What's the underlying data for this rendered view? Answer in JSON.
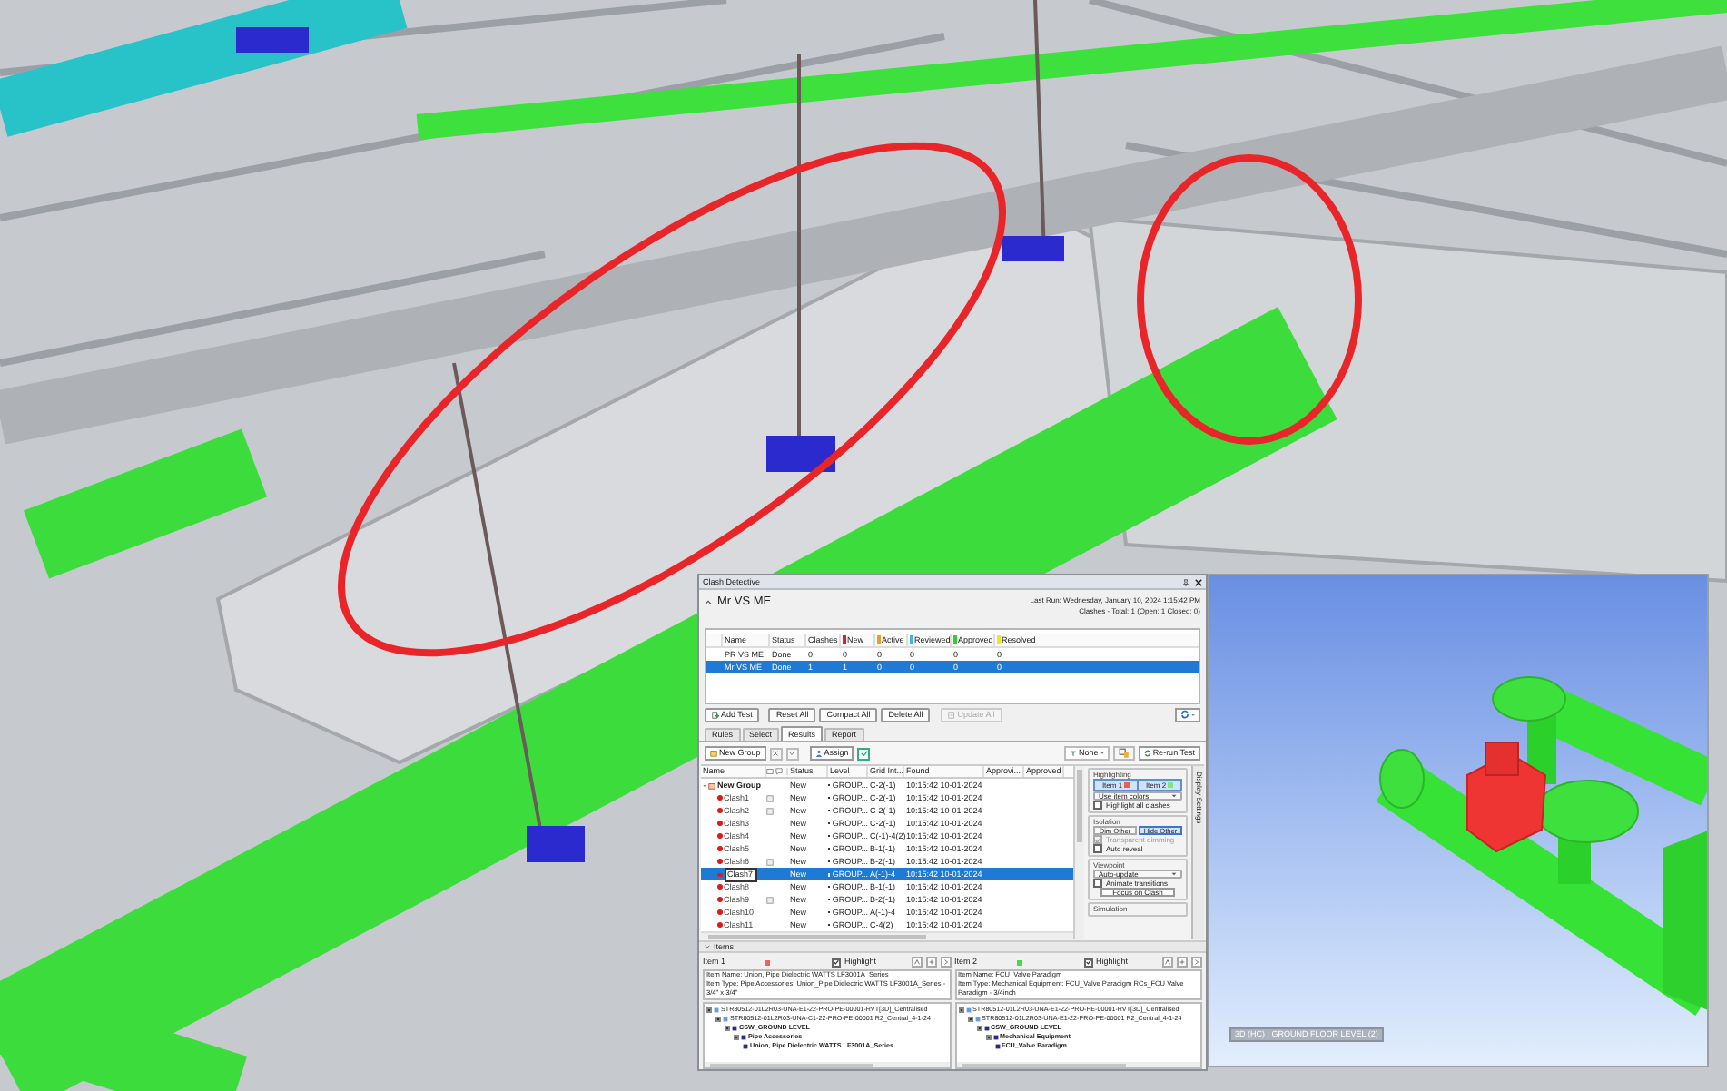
{
  "panel": {
    "title": "Clash Detective",
    "test_name": "Mr VS ME",
    "expanded": true,
    "last_run": "Last Run: Wednesday, January 10, 2024 1:15:42 PM",
    "summary": "Clashes - Total: 1  (Open: 1  Closed: 0)",
    "tests": {
      "columns": [
        {
          "label": "Name"
        },
        {
          "label": "Status"
        },
        {
          "label": "Clashes"
        },
        {
          "label": "New",
          "color": "#e02020"
        },
        {
          "label": "Active",
          "color": "#f39a1f"
        },
        {
          "label": "Reviewed",
          "color": "#3ab8e8"
        },
        {
          "label": "Approved",
          "color": "#2ed12e"
        },
        {
          "label": "Resolved",
          "color": "#f2e22a"
        }
      ],
      "rows": [
        {
          "cells": [
            "PR VS ME",
            "Done",
            "0",
            "0",
            "0",
            "0",
            "0",
            "0"
          ],
          "selected": false
        },
        {
          "cells": [
            "Mr VS ME",
            "Done",
            "1",
            "1",
            "0",
            "0",
            "0",
            "0"
          ],
          "selected": true
        }
      ]
    },
    "test_buttons": [
      {
        "label": "Add Test",
        "kind": "add",
        "disabled": false
      },
      {
        "label": "Reset All",
        "kind": "plain",
        "disabled": false
      },
      {
        "label": "Compact All",
        "kind": "plain",
        "disabled": false
      },
      {
        "label": "Delete All",
        "kind": "plain",
        "disabled": false
      },
      {
        "label": "Update All",
        "kind": "update",
        "disabled": true
      }
    ],
    "tabs": [
      {
        "label": "Rules",
        "selected": false
      },
      {
        "label": "Select",
        "selected": false
      },
      {
        "label": "Results",
        "selected": true
      },
      {
        "label": "Report",
        "selected": false
      }
    ],
    "toolbar": {
      "new_group": "New Group",
      "assign": "Assign",
      "filter": "None",
      "rerun": "Re-run Test"
    },
    "results": {
      "columns": [
        "Name",
        "Status",
        "Level",
        "Grid Int...",
        "Found",
        "Approvi...",
        "Approved"
      ],
      "rows": [
        {
          "name": "New Group",
          "expanded": true,
          "selected": false,
          "status": "New",
          "level": "GROUP...",
          "grid": "C-2(-1)",
          "found": "10:15:42 10-01-2024",
          "children": [
            {
              "name": "Clash1",
              "selected": false,
              "comment": true,
              "status": "New",
              "level": "GROUP...",
              "grid": "C-2(-1)",
              "found": "10:15:42 10-01-2024"
            },
            {
              "name": "Clash2",
              "selected": false,
              "comment": true,
              "status": "New",
              "level": "GROUP...",
              "grid": "C-2(-1)",
              "found": "10:15:42 10-01-2024"
            },
            {
              "name": "Clash3",
              "selected": false,
              "comment": false,
              "status": "New",
              "level": "GROUP...",
              "grid": "C-2(-1)",
              "found": "10:15:42 10-01-2024"
            },
            {
              "name": "Clash4",
              "selected": false,
              "comment": false,
              "status": "New",
              "level": "GROUP...",
              "grid": "C(-1)-4(2)",
              "found": "10:15:42 10-01-2024"
            },
            {
              "name": "Clash5",
              "selected": false,
              "comment": false,
              "status": "New",
              "level": "GROUP...",
              "grid": "B-1(-1)",
              "found": "10:15:42 10-01-2024"
            },
            {
              "name": "Clash6",
              "selected": false,
              "comment": true,
              "status": "New",
              "level": "GROUP...",
              "grid": "B-2(-1)",
              "found": "10:15:42 10-01-2024"
            },
            {
              "name": "Clash7",
              "selected": true,
              "comment": false,
              "status": "New",
              "level": "GROUP...",
              "grid": "A(-1)-4",
              "found": "10:15:42 10-01-2024"
            },
            {
              "name": "Clash8",
              "selected": false,
              "comment": false,
              "status": "New",
              "level": "GROUP...",
              "grid": "B-1(-1)",
              "found": "10:15:42 10-01-2024"
            },
            {
              "name": "Clash9",
              "selected": false,
              "comment": true,
              "status": "New",
              "level": "GROUP...",
              "grid": "B-2(-1)",
              "found": "10:15:42 10-01-2024"
            },
            {
              "name": "Clash10",
              "selected": false,
              "comment": false,
              "status": "New",
              "level": "GROUP...",
              "grid": "A(-1)-4",
              "found": "10:15:42 10-01-2024"
            },
            {
              "name": "Clash11",
              "selected": false,
              "comment": false,
              "status": "New",
              "level": "GROUP...",
              "grid": "C-4(2)",
              "found": "10:15:42 10-01-2024"
            }
          ]
        }
      ]
    },
    "settings": {
      "title": "Display Settings",
      "highlighting": {
        "title": "Highlighting",
        "items": [
          {
            "label": "Item 1",
            "color": "#ef5b5b"
          },
          {
            "label": "Item 2",
            "color": "#7ee87e"
          }
        ],
        "mode": "Use item colors",
        "highlight_all": {
          "label": "Highlight all clashes",
          "checked": false
        }
      },
      "isolation": {
        "title": "Isolation",
        "options": [
          {
            "label": "Dim Other",
            "selected": false
          },
          {
            "label": "Hide Other",
            "selected": true
          }
        ],
        "checks": [
          {
            "label": "Transparent dimming",
            "checked": true,
            "disabled": true
          },
          {
            "label": "Auto reveal",
            "checked": false,
            "disabled": false
          }
        ]
      },
      "viewpoint": {
        "title": "Viewpoint",
        "mode": "Auto-update",
        "animate": {
          "label": "Animate transitions",
          "checked": false
        },
        "focus": "Focus on Clash"
      },
      "simulation": {
        "title": "Simulation"
      }
    },
    "items": {
      "title": "Items",
      "expanded": true,
      "panes": [
        {
          "label": "Item 1",
          "color": "#f06060",
          "highlight": {
            "label": "Highlight",
            "checked": true
          },
          "description": [
            "Item Name: Union, Pipe Dielectric WATTS LF3001A_Series",
            "Item Type: Pipe Accessories: Union_Pipe Dielectric WATTS LF3001A_Series - 3/4\" x 3/4\""
          ],
          "tree": [
            {
              "label": "STR80512-01L2R03-UNA-E1-22-PRO-PE-00001-RVT[3D]_Centralised",
              "expanded": true,
              "children": [
                {
                  "label": "STR80512-01L2R03-UNA-C1-22-PRO-PE-00001 R2_Central_4-1-24",
                  "expanded": true,
                  "children": [
                    {
                      "label": "CSW_GROUND LEVEL",
                      "expanded": true,
                      "children": [
                        {
                          "label": "Pipe Accessories",
                          "expanded": true,
                          "children": [
                            {
                              "label": "Union, Pipe Dielectric WATTS LF3001A_Series"
                            }
                          ]
                        }
                      ]
                    }
                  ]
                }
              ]
            }
          ]
        },
        {
          "label": "Item 2",
          "color": "#3ee03e",
          "highlight": {
            "label": "Highlight",
            "checked": true
          },
          "description": [
            "Item Name: FCU_Valve Paradigm",
            "Item Type: Mechanical Equipment: FCU_Valve Paradigm RCs_FCU Valve Paradigm - 3/4inch"
          ],
          "tree": [
            {
              "label": "STR80512-01L2R03-UNA-E1-22-PRO-PE-00001-RVT[3D]_Centralised",
              "expanded": true,
              "children": [
                {
                  "label": "STR80512-01L2R03-UNA-E1-22-PRO-PE-00001 R2_Central_4-1-24",
                  "expanded": true,
                  "children": [
                    {
                      "label": "CSW_GROUND LEVEL",
                      "expanded": true,
                      "children": [
                        {
                          "label": "Mechanical Equipment",
                          "expanded": true,
                          "children": [
                            {
                              "label": "FCU_Valve Paradigm"
                            }
                          ]
                        }
                      ]
                    }
                  ]
                }
              ]
            }
          ]
        }
      ]
    }
  },
  "viewer": {
    "label": "3D (HC) : GROUND FLOOR LEVEL (2)"
  }
}
